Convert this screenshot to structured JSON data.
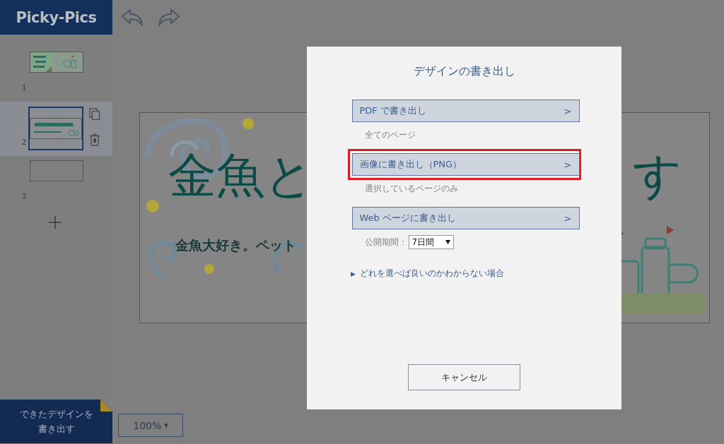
{
  "app": {
    "logo": "Picky-Pics"
  },
  "pages": [
    {
      "number": "1",
      "kind": "cover",
      "selected": false
    },
    {
      "number": "2",
      "kind": "banner",
      "selected": true
    },
    {
      "number": "3",
      "kind": "blank",
      "selected": false
    }
  ],
  "export_button": [
    "できたデザインを",
    "書き出す"
  ],
  "zoom": {
    "value": "100%",
    "arrow": "▾"
  },
  "canvas": {
    "title_parts": [
      "金魚と",
      "す"
    ],
    "subtitle": "金魚大好き。ペット"
  },
  "dialog": {
    "title": "デザインの書き出し",
    "options": [
      {
        "kind": "note",
        "label": "PDF で書き出し",
        "arrow": ">",
        "note": "全てのページ",
        "highlighted": false
      },
      {
        "kind": "note",
        "label": "画像に書き出し（PNG）",
        "arrow": ">",
        "note": "選択しているページのみ",
        "highlighted": true
      },
      {
        "kind": "period",
        "label": "Web ページに書き出し",
        "arrow": ">",
        "period_label": "公開期間：",
        "period_value": "7日間",
        "highlighted": false
      }
    ],
    "help": {
      "marker": "▶",
      "text": "どれを選べば良いのかわからない場合"
    },
    "cancel": "キャンセル"
  }
}
